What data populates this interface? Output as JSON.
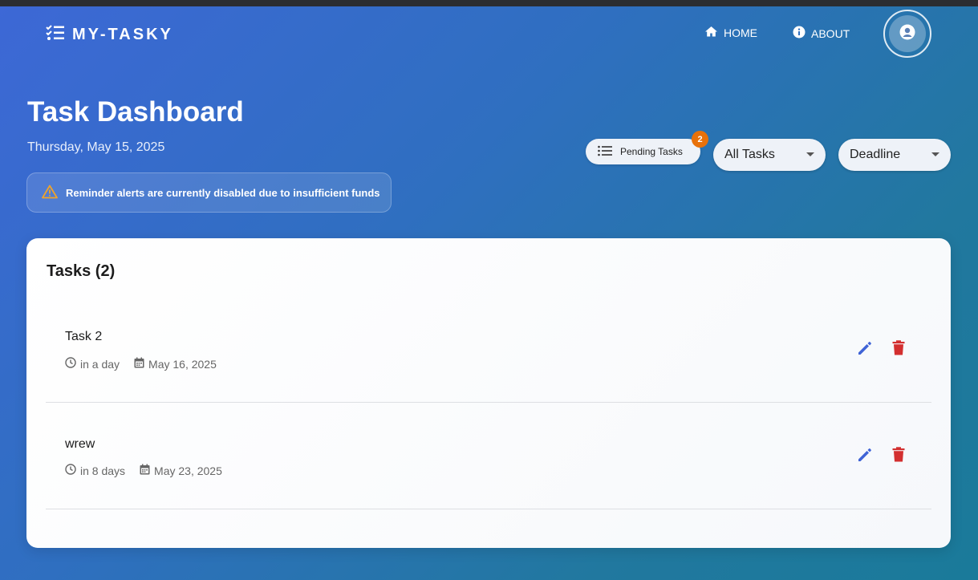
{
  "nav": {
    "brand": "MY-TASKY",
    "home": "HOME",
    "about": "ABOUT"
  },
  "header": {
    "title": "Task Dashboard",
    "date": "Thursday, May 15, 2025",
    "alert": "Reminder alerts are currently disabled due to insufficient funds"
  },
  "controls": {
    "pending_label": "Pending Tasks",
    "pending_count": "2",
    "filter_value": "All Tasks",
    "sort_value": "Deadline"
  },
  "tasks_panel": {
    "title": "Tasks (2)",
    "items": [
      {
        "name": "Task 2",
        "relative": "in a day",
        "date": "May 16, 2025"
      },
      {
        "name": "wrew",
        "relative": "in 8 days",
        "date": "May 23, 2025"
      }
    ]
  },
  "colors": {
    "edit": "#3f63d6",
    "delete": "#d32f2f",
    "badge": "#e8710a",
    "warning": "#f0a32a"
  }
}
